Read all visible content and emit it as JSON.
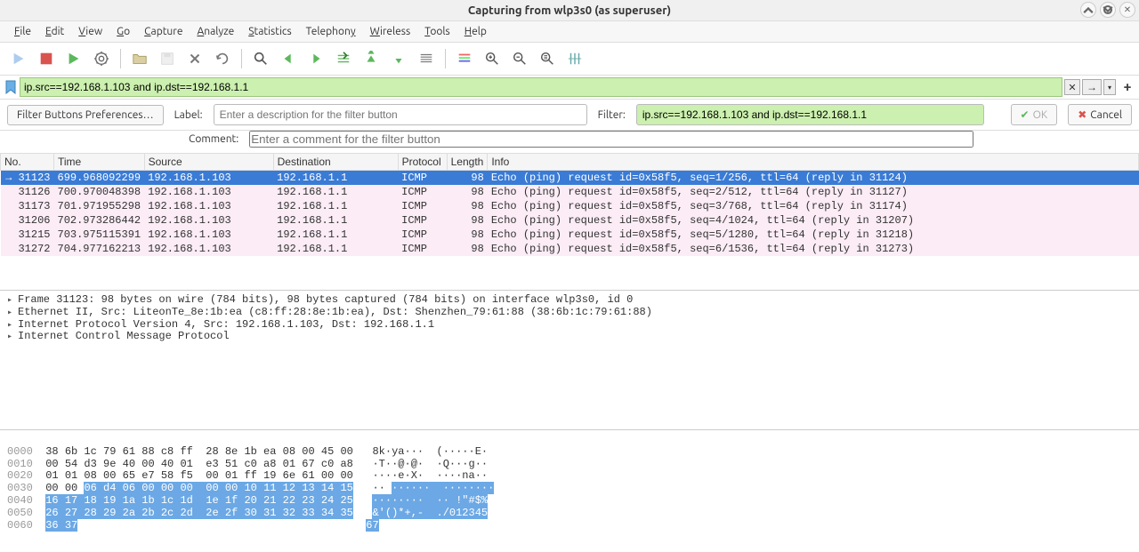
{
  "window": {
    "title": "Capturing from wlp3s0 (as superuser)"
  },
  "menu": {
    "file": "File",
    "edit": "Edit",
    "view": "View",
    "go": "Go",
    "capture": "Capture",
    "analyze": "Analyze",
    "statistics": "Statistics",
    "telephony": "Telephony",
    "wireless": "Wireless",
    "tools": "Tools",
    "help": "Help"
  },
  "filter": {
    "value": "ip.src==192.168.1.103 and ip.dst==192.168.1.1"
  },
  "filter_buttons": {
    "prefs_label": "Filter Buttons Preferences…",
    "label_label": "Label:",
    "label_placeholder": "Enter a description for the filter button",
    "filter_label": "Filter:",
    "filter_value": "ip.src==192.168.1.103 and ip.dst==192.168.1.1",
    "comment_label": "Comment:",
    "comment_placeholder": "Enter a comment for the filter button",
    "ok_label": "OK",
    "cancel_label": "Cancel"
  },
  "columns": {
    "no": "No.",
    "time": "Time",
    "source": "Source",
    "destination": "Destination",
    "protocol": "Protocol",
    "length": "Length",
    "info": "Info"
  },
  "packets": [
    {
      "no": "31123",
      "time": "699.968092299",
      "src": "192.168.1.103",
      "dst": "192.168.1.1",
      "proto": "ICMP",
      "len": "98",
      "info": "Echo (ping) request  id=0x58f5, seq=1/256, ttl=64 (reply in 31124)"
    },
    {
      "no": "31126",
      "time": "700.970048398",
      "src": "192.168.1.103",
      "dst": "192.168.1.1",
      "proto": "ICMP",
      "len": "98",
      "info": "Echo (ping) request  id=0x58f5, seq=2/512, ttl=64 (reply in 31127)"
    },
    {
      "no": "31173",
      "time": "701.971955298",
      "src": "192.168.1.103",
      "dst": "192.168.1.1",
      "proto": "ICMP",
      "len": "98",
      "info": "Echo (ping) request  id=0x58f5, seq=3/768, ttl=64 (reply in 31174)"
    },
    {
      "no": "31206",
      "time": "702.973286442",
      "src": "192.168.1.103",
      "dst": "192.168.1.1",
      "proto": "ICMP",
      "len": "98",
      "info": "Echo (ping) request  id=0x58f5, seq=4/1024, ttl=64 (reply in 31207)"
    },
    {
      "no": "31215",
      "time": "703.975115391",
      "src": "192.168.1.103",
      "dst": "192.168.1.1",
      "proto": "ICMP",
      "len": "98",
      "info": "Echo (ping) request  id=0x58f5, seq=5/1280, ttl=64 (reply in 31218)"
    },
    {
      "no": "31272",
      "time": "704.977162213",
      "src": "192.168.1.103",
      "dst": "192.168.1.1",
      "proto": "ICMP",
      "len": "98",
      "info": "Echo (ping) request  id=0x58f5, seq=6/1536, ttl=64 (reply in 31273)"
    }
  ],
  "details": {
    "line0": "Frame 31123: 98 bytes on wire (784 bits), 98 bytes captured (784 bits) on interface wlp3s0, id 0",
    "line1": "Ethernet II, Src: LiteonTe_8e:1b:ea (c8:ff:28:8e:1b:ea), Dst: Shenzhen_79:61:88 (38:6b:1c:79:61:88)",
    "line2": "Internet Protocol Version 4, Src: 192.168.1.103, Dst: 192.168.1.1",
    "line3": "Internet Control Message Protocol"
  },
  "hex": {
    "r0": {
      "off": "0000",
      "h": "38 6b 1c 79 61 88 c8 ff  28 8e 1b ea 08 00 45 00",
      "a": "8k·ya···  (·····E·"
    },
    "r1": {
      "off": "0010",
      "h": "00 54 d3 9e 40 00 40 01  e3 51 c0 a8 01 67 c0 a8",
      "a": "·T··@·@·  ·Q···g··"
    },
    "r2": {
      "off": "0020",
      "h": "01 01 08 00 65 e7 58 f5  00 01 ff 19 6e 61 00 00",
      "a": "····e·X·  ····na··"
    },
    "r3": {
      "off": "0030",
      "h1": "00 00 ",
      "h2": "06 d4 06 00 00 00  00 00 10 11 12 13 14 15",
      "a1": "·· ",
      "a2": "······  ········"
    },
    "r4": {
      "off": "0040",
      "h": "16 17 18 19 1a 1b 1c 1d  1e 1f 20 21 22 23 24 25",
      "a": "········  ·· !\"#$%"
    },
    "r5": {
      "off": "0050",
      "h": "26 27 28 29 2a 2b 2c 2d  2e 2f 30 31 32 33 34 35",
      "a": "&'()*+,-  ./012345"
    },
    "r6": {
      "off": "0060",
      "h": "36 37",
      "a": "67"
    }
  }
}
